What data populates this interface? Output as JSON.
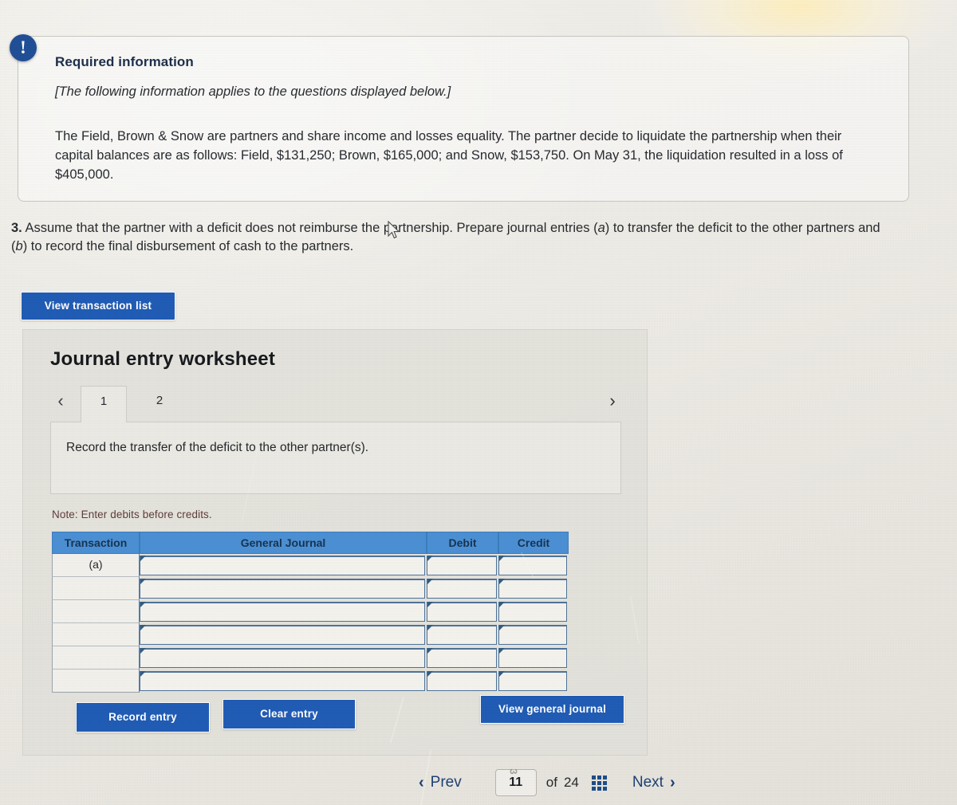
{
  "alert": {
    "icon": "exclamation-icon"
  },
  "required_info": {
    "title": "Required information",
    "italic_note": "[The following information applies to the questions displayed below.]",
    "body": "The Field, Brown & Snow are partners and share income and losses equality. The partner decide to liquidate the partnership when their capital balances are as follows: Field, $131,250; Brown, $165,000; and Snow, $153,750. On May 31, the liquidation resulted in a loss of $405,000."
  },
  "question": {
    "number": "3.",
    "text_part1": " Assume that the partner with a deficit does not reimburse the partnership. Prepare journal entries (",
    "label_a": "a",
    "text_part2": ") to transfer the deficit to the other partners and (",
    "label_b": "b",
    "text_part3": ") to record the final disbursement of cash to the partners."
  },
  "toolbar": {
    "view_transaction_list": "View transaction list"
  },
  "worksheet": {
    "title": "Journal entry worksheet",
    "prev_arrow": "‹",
    "next_arrow": "›",
    "tabs": [
      {
        "label": "1",
        "active": true
      },
      {
        "label": "2",
        "active": false
      }
    ],
    "instruction": "Record the transfer of the deficit to the other partner(s).",
    "note": "Note: Enter debits before credits.",
    "table": {
      "headers": [
        "Transaction",
        "General Journal",
        "Debit",
        "Credit"
      ],
      "rows": [
        {
          "transaction": "(a)",
          "general_journal": "",
          "debit": "",
          "credit": ""
        },
        {
          "transaction": "",
          "general_journal": "",
          "debit": "",
          "credit": ""
        },
        {
          "transaction": "",
          "general_journal": "",
          "debit": "",
          "credit": ""
        },
        {
          "transaction": "",
          "general_journal": "",
          "debit": "",
          "credit": ""
        },
        {
          "transaction": "",
          "general_journal": "",
          "debit": "",
          "credit": ""
        },
        {
          "transaction": "",
          "general_journal": "",
          "debit": "",
          "credit": ""
        }
      ]
    },
    "buttons": {
      "record_entry": "Record entry",
      "clear_entry": "Clear entry",
      "view_general_journal": "View general journal"
    }
  },
  "footer": {
    "prev_label": "Prev",
    "next_label": "Next",
    "prev_chevron": "‹",
    "next_chevron": "›",
    "current_page": "11",
    "of_label": "of",
    "total_pages": "24",
    "ghost_artifact": "3",
    "grid_icon": "grid-icon"
  },
  "colors": {
    "accent_blue": "#1f5bb5",
    "table_header_blue": "#4a8fd4",
    "badge_blue": "#1f4e96",
    "note_maroon": "#5e3b3b"
  }
}
